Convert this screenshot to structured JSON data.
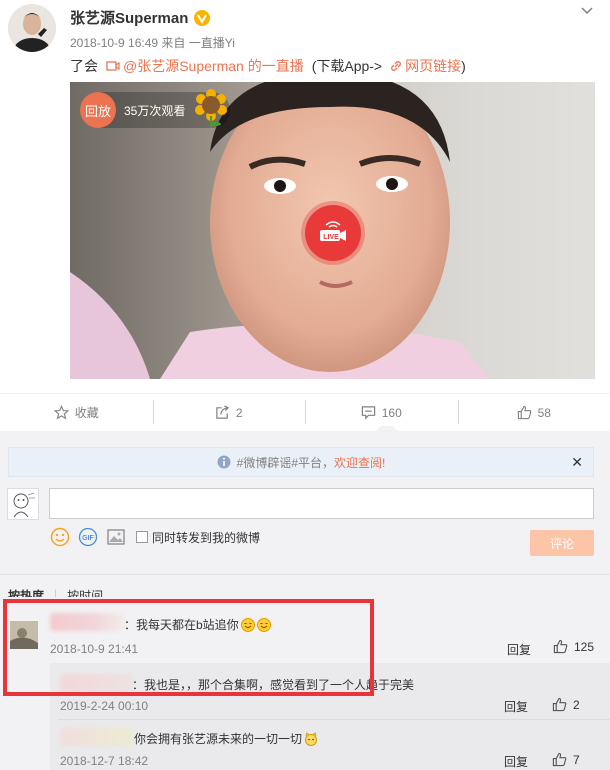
{
  "post": {
    "author": "张艺源Superman",
    "meta": "2018-10-9 16:49 来自 一直播Yi",
    "text_prefix": "了会",
    "live_link": "@张艺源Superman 的一直播",
    "download": "(下载App->",
    "web_link": "网页链接",
    "close_paren": ")",
    "video": {
      "replay_label": "回放",
      "views": "35万次观看",
      "live_label": "LIVE"
    }
  },
  "actions": {
    "favorite": "收藏",
    "forward_count": "2",
    "comment_count": "160",
    "like_count": "58"
  },
  "comments": {
    "notice_text": "#微博辟谣#平台，",
    "notice_link": "欢迎查阅!",
    "forward_label": "同时转发到我的微博",
    "submit_label": "评论",
    "sort_hot": "按热度",
    "sort_time": "按时间",
    "items": [
      {
        "text": "：我每天都在b站追你",
        "date": "2018-10-9 21:41",
        "reply": "回复",
        "likes": "125"
      },
      {
        "text": "：我也是，，那个合集啊，感觉看到了一个人趋于完美",
        "date": "2019-2-24 00:10",
        "reply": "回复",
        "likes": "2"
      },
      {
        "text": "你会拥有张艺源未来的一切一切",
        "date": "2018-12-7 18:42",
        "reply": "回复",
        "likes": "7"
      }
    ]
  },
  "colors": {
    "accent": "#eb7350",
    "highlight_box": "#e8353a",
    "live_red": "#e83a38",
    "comment_bg": "#f2f2f5"
  },
  "icons": [
    "chevron-down-icon",
    "verified-icon",
    "video-link-icon",
    "link-icon",
    "star-icon",
    "forward-icon",
    "comment-icon",
    "like-icon",
    "info-icon",
    "close-icon",
    "emoji-icon",
    "gif-icon",
    "image-icon",
    "live-camera-icon"
  ]
}
